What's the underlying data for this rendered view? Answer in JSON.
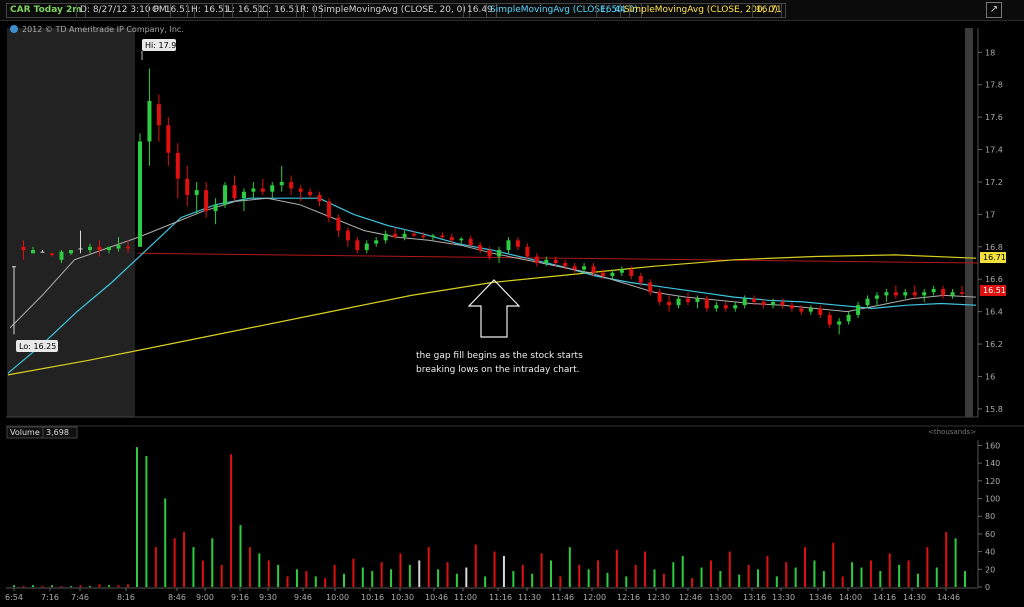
{
  "header": {
    "ticker": "CAR Today 2m",
    "date": "D: 8/27/12 3:10 PM",
    "open": "O: 16.51",
    "high": "H: 16.51",
    "low": "L: 16.51",
    "close": "C: 16.51",
    "range": "R: 0",
    "sma20_label": "SimpleMovingAvg (CLOSE, 20, 0)",
    "sma20_value": "16.49",
    "sma50_label": "SimpleMovingAvg (CLOSE, 50, 0)",
    "sma50_value": "16.44",
    "sma200_label": "SimpleMovingAvg (CLOSE, 200, 0)",
    "sma200_value": "16.71"
  },
  "copyright": "2012 © TD Ameritrade IP Company, Inc.",
  "colors": {
    "up": "#2ecc40",
    "down": "#e01010",
    "flat": "#d8d8d8",
    "sma20": "#b0b0b0",
    "sma50": "#3ec6e0",
    "sma200": "#d8d020",
    "ref": "#b01818"
  },
  "icons": [
    "maximize-icon",
    "arrow-up-icon",
    "info-icon"
  ],
  "chart_data": [
    {
      "type": "candlestick",
      "title": "CAR Today 2m",
      "x_ticks": [
        "6:54",
        "7:16",
        "7:46",
        "8:16",
        "8:46",
        "9:00",
        "9:16",
        "9:30",
        "9:46",
        "10:00",
        "10:16",
        "10:30",
        "10:46",
        "11:00",
        "11:16",
        "11:30",
        "11:46",
        "12:00",
        "12:16",
        "12:30",
        "12:46",
        "13:00",
        "13:16",
        "13:30",
        "13:46",
        "14:00",
        "14:16",
        "14:30",
        "14:46"
      ],
      "y_ticks": [
        "18",
        "17.8",
        "17.6",
        "17.4",
        "17.2",
        "17",
        "16.8",
        "16.6",
        "16.4",
        "16.2",
        "16",
        "15.8"
      ],
      "ylim": [
        15.75,
        18.15
      ],
      "premarket_shaded": true,
      "hi_label": "Hi: 17.9",
      "lo_label": "Lo: 16.25",
      "price_tags": {
        "sma200": "16.71",
        "last": "16.51"
      },
      "annotation": {
        "line1": "the gap fill begins as the stock starts",
        "line2": "breaking lows on the intraday chart."
      },
      "reference_level": 16.76,
      "series_sma200_endpoints": [
        16.01,
        16.73
      ],
      "candles": [
        [
          16.68,
          16.68,
          16.26,
          16.68
        ],
        [
          16.8,
          16.84,
          16.72,
          16.78
        ],
        [
          16.76,
          16.8,
          16.76,
          16.78
        ],
        [
          16.77,
          16.78,
          16.77,
          16.77
        ],
        [
          16.76,
          16.76,
          16.74,
          16.75
        ],
        [
          16.72,
          16.78,
          16.7,
          16.77
        ],
        [
          16.76,
          16.78,
          16.75,
          16.78
        ],
        [
          16.79,
          16.9,
          16.76,
          16.79
        ],
        [
          16.78,
          16.82,
          16.76,
          16.8
        ],
        [
          16.8,
          16.84,
          16.74,
          16.78
        ],
        [
          16.78,
          16.8,
          16.76,
          16.8
        ],
        [
          16.79,
          16.86,
          16.77,
          16.81
        ],
        [
          16.8,
          16.84,
          16.76,
          16.79
        ],
        [
          16.8,
          17.5,
          16.8,
          17.45
        ],
        [
          17.45,
          17.9,
          17.3,
          17.7
        ],
        [
          17.68,
          17.74,
          17.45,
          17.55
        ],
        [
          17.55,
          17.6,
          17.3,
          17.38
        ],
        [
          17.38,
          17.44,
          17.1,
          17.22
        ],
        [
          17.22,
          17.3,
          17.05,
          17.12
        ],
        [
          17.12,
          17.2,
          17.0,
          17.15
        ],
        [
          17.15,
          17.2,
          16.98,
          17.02
        ],
        [
          17.02,
          17.1,
          16.94,
          17.06
        ],
        [
          17.06,
          17.2,
          17.04,
          17.18
        ],
        [
          17.18,
          17.24,
          17.08,
          17.1
        ],
        [
          17.1,
          17.16,
          17.02,
          17.14
        ],
        [
          17.14,
          17.2,
          17.1,
          17.16
        ],
        [
          17.16,
          17.22,
          17.12,
          17.14
        ],
        [
          17.14,
          17.2,
          17.1,
          17.18
        ],
        [
          17.18,
          17.3,
          17.14,
          17.2
        ],
        [
          17.2,
          17.24,
          17.12,
          17.16
        ],
        [
          17.16,
          17.18,
          17.08,
          17.14
        ],
        [
          17.14,
          17.16,
          17.1,
          17.12
        ],
        [
          17.12,
          17.14,
          17.05,
          17.08
        ],
        [
          17.08,
          17.1,
          16.95,
          16.98
        ],
        [
          16.98,
          17.0,
          16.86,
          16.9
        ],
        [
          16.9,
          16.92,
          16.8,
          16.84
        ],
        [
          16.84,
          16.86,
          16.76,
          16.78
        ],
        [
          16.78,
          16.84,
          16.76,
          16.82
        ],
        [
          16.82,
          16.86,
          16.8,
          16.84
        ],
        [
          16.84,
          16.9,
          16.82,
          16.88
        ],
        [
          16.88,
          16.92,
          16.85,
          16.86
        ],
        [
          16.86,
          16.9,
          16.84,
          16.88
        ],
        [
          16.88,
          16.9,
          16.86,
          16.87
        ],
        [
          16.87,
          16.89,
          16.85,
          16.86
        ],
        [
          16.86,
          16.88,
          16.84,
          16.87
        ],
        [
          16.87,
          16.89,
          16.85,
          16.86
        ],
        [
          16.86,
          16.88,
          16.82,
          16.84
        ],
        [
          16.84,
          16.86,
          16.82,
          16.85
        ],
        [
          16.85,
          16.87,
          16.8,
          16.81
        ],
        [
          16.81,
          16.83,
          16.76,
          16.78
        ],
        [
          16.78,
          16.8,
          16.72,
          16.74
        ],
        [
          16.74,
          16.8,
          16.7,
          16.78
        ],
        [
          16.78,
          16.86,
          16.76,
          16.84
        ],
        [
          16.84,
          16.86,
          16.78,
          16.8
        ],
        [
          16.8,
          16.82,
          16.72,
          16.74
        ],
        [
          16.74,
          16.76,
          16.68,
          16.7
        ],
        [
          16.7,
          16.74,
          16.68,
          16.72
        ],
        [
          16.72,
          16.74,
          16.68,
          16.7
        ],
        [
          16.7,
          16.72,
          16.66,
          16.68
        ],
        [
          16.68,
          16.7,
          16.64,
          16.66
        ],
        [
          16.66,
          16.7,
          16.64,
          16.68
        ],
        [
          16.68,
          16.7,
          16.62,
          16.64
        ],
        [
          16.64,
          16.66,
          16.6,
          16.62
        ],
        [
          16.62,
          16.66,
          16.6,
          16.64
        ],
        [
          16.64,
          16.68,
          16.62,
          16.66
        ],
        [
          16.66,
          16.68,
          16.6,
          16.62
        ],
        [
          16.62,
          16.64,
          16.56,
          16.58
        ],
        [
          16.58,
          16.6,
          16.5,
          16.52
        ],
        [
          16.52,
          16.54,
          16.44,
          16.46
        ],
        [
          16.46,
          16.5,
          16.4,
          16.44
        ],
        [
          16.44,
          16.5,
          16.42,
          16.48
        ],
        [
          16.48,
          16.52,
          16.44,
          16.46
        ],
        [
          16.46,
          16.5,
          16.42,
          16.48
        ],
        [
          16.48,
          16.5,
          16.4,
          16.42
        ],
        [
          16.42,
          16.46,
          16.4,
          16.44
        ],
        [
          16.44,
          16.46,
          16.4,
          16.42
        ],
        [
          16.42,
          16.46,
          16.4,
          16.44
        ],
        [
          16.44,
          16.5,
          16.42,
          16.48
        ],
        [
          16.48,
          16.5,
          16.44,
          16.46
        ],
        [
          16.46,
          16.48,
          16.42,
          16.44
        ],
        [
          16.44,
          16.48,
          16.42,
          16.46
        ],
        [
          16.46,
          16.48,
          16.42,
          16.44
        ],
        [
          16.44,
          16.46,
          16.4,
          16.42
        ],
        [
          16.42,
          16.44,
          16.38,
          16.4
        ],
        [
          16.4,
          16.44,
          16.38,
          16.42
        ],
        [
          16.42,
          16.44,
          16.36,
          16.38
        ],
        [
          16.38,
          16.4,
          16.3,
          16.32
        ],
        [
          16.32,
          16.36,
          16.26,
          16.34
        ],
        [
          16.34,
          16.4,
          16.32,
          16.38
        ],
        [
          16.38,
          16.46,
          16.36,
          16.44
        ],
        [
          16.44,
          16.5,
          16.42,
          16.48
        ],
        [
          16.48,
          16.52,
          16.44,
          16.5
        ],
        [
          16.5,
          16.54,
          16.46,
          16.52
        ],
        [
          16.52,
          16.56,
          16.48,
          16.5
        ],
        [
          16.5,
          16.54,
          16.48,
          16.52
        ],
        [
          16.52,
          16.56,
          16.48,
          16.5
        ],
        [
          16.5,
          16.54,
          16.46,
          16.52
        ],
        [
          16.52,
          16.56,
          16.5,
          16.54
        ],
        [
          16.54,
          16.56,
          16.48,
          16.5
        ],
        [
          16.5,
          16.54,
          16.48,
          16.52
        ],
        [
          16.52,
          16.56,
          16.5,
          16.51
        ]
      ],
      "series_sma20": [
        16.3,
        16.5,
        16.72,
        16.79,
        16.86,
        16.94,
        17.02,
        17.08,
        17.1,
        17.06,
        16.98,
        16.9,
        16.86,
        16.84,
        16.81,
        16.76,
        16.72,
        16.68,
        16.64,
        16.58,
        16.52,
        16.49,
        16.47,
        16.45,
        16.44,
        16.42,
        16.4,
        16.44,
        16.48,
        16.5,
        16.49
      ],
      "series_sma50": [
        16.02,
        16.2,
        16.4,
        16.58,
        16.78,
        16.98,
        17.06,
        17.1,
        17.1,
        17.1,
        17.0,
        16.93,
        16.88,
        16.82,
        16.78,
        16.73,
        16.68,
        16.62,
        16.58,
        16.55,
        16.52,
        16.49,
        16.47,
        16.46,
        16.44,
        16.42,
        16.44,
        16.45,
        16.44
      ],
      "series_sma200": [
        16.01,
        16.1,
        16.2,
        16.3,
        16.4,
        16.5,
        16.58,
        16.63,
        16.68,
        16.72,
        16.74,
        16.75,
        16.73
      ]
    },
    {
      "type": "bar",
      "title": "Volume",
      "value_label": "3,698",
      "units_label": "<thousands>",
      "y_ticks": [
        "160",
        "140",
        "120",
        "100",
        "80",
        "60",
        "40",
        "20",
        "0"
      ],
      "ylim": [
        0,
        165
      ],
      "values": [
        2,
        1,
        2,
        1,
        2,
        1,
        1,
        2,
        1,
        3,
        2,
        2,
        3,
        158,
        148,
        45,
        100,
        55,
        62,
        45,
        30,
        55,
        25,
        150,
        70,
        45,
        38,
        30,
        25,
        12,
        20,
        18,
        12,
        10,
        25,
        15,
        32,
        22,
        18,
        28,
        20,
        38,
        25,
        30,
        45,
        20,
        28,
        15,
        22,
        48,
        12,
        40,
        35,
        18,
        25,
        15,
        38,
        30,
        12,
        45,
        25,
        20,
        30,
        16,
        42,
        12,
        25,
        40,
        20,
        15,
        28,
        35,
        10,
        22,
        30,
        18,
        40,
        14,
        25,
        20,
        35,
        12,
        28,
        22,
        45,
        30,
        18,
        50,
        12,
        28,
        22,
        30,
        18,
        38,
        25,
        30,
        15,
        45,
        22,
        62,
        55,
        18
      ],
      "colors": [
        "u",
        "d",
        "u",
        "d",
        "u",
        "d",
        "u",
        "d",
        "u",
        "d",
        "u",
        "d",
        "d",
        "u",
        "u",
        "d",
        "u",
        "d",
        "d",
        "u",
        "d",
        "u",
        "d",
        "d",
        "u",
        "d",
        "u",
        "d",
        "u",
        "d",
        "u",
        "d",
        "u",
        "d",
        "d",
        "u",
        "d",
        "u",
        "u",
        "d",
        "u",
        "d",
        "u",
        "w",
        "d",
        "u",
        "d",
        "u",
        "w",
        "d",
        "u",
        "d",
        "w",
        "u",
        "d",
        "u",
        "d",
        "u",
        "d",
        "u",
        "d",
        "u",
        "d",
        "u",
        "d",
        "u",
        "d",
        "d",
        "u",
        "d",
        "u",
        "u",
        "d",
        "u",
        "d",
        "u",
        "d",
        "u",
        "d",
        "u",
        "d",
        "u",
        "d",
        "u",
        "d",
        "u",
        "u",
        "d",
        "d",
        "u",
        "u",
        "d",
        "u",
        "d",
        "u",
        "d",
        "u",
        "d",
        "u",
        "d",
        "u",
        "u",
        "u"
      ]
    }
  ]
}
